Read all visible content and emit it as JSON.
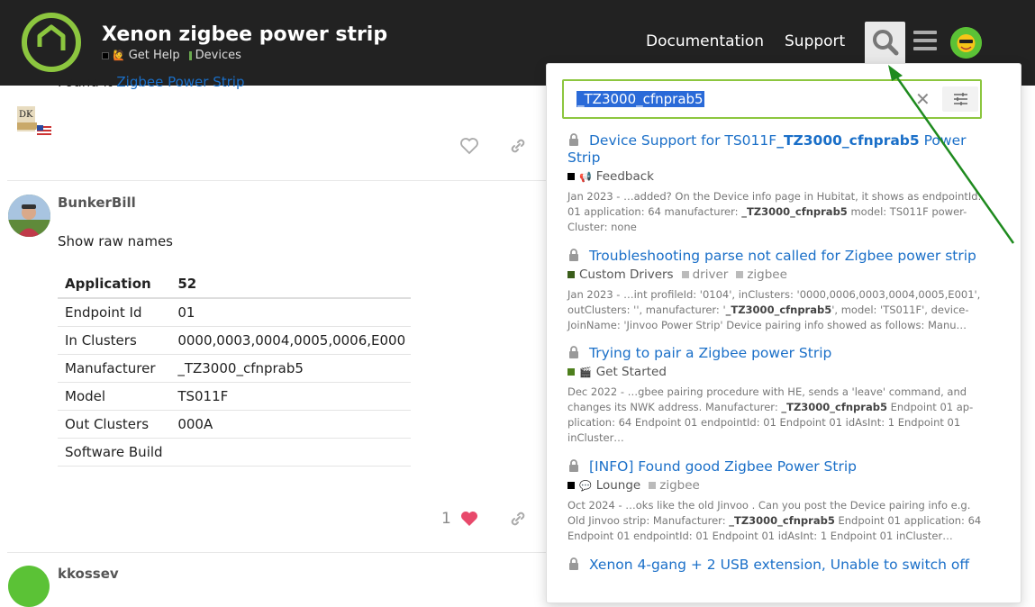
{
  "header": {
    "title": "Xenon zigbee power strip",
    "breadcrumbs": [
      {
        "label": "Get Help",
        "color": "#ffffff",
        "emoji": "🙋"
      },
      {
        "label": "Devices",
        "color": "#6aa84f"
      }
    ],
    "nav": {
      "documentation": "Documentation",
      "support": "Support"
    },
    "icons": {
      "search": "search-icon",
      "menu": "hamburger-icon",
      "avatar": "user-avatar"
    }
  },
  "topic": {
    "prev_post": {
      "text": "Found it ",
      "link": "Zigbee Power Strip"
    },
    "post": {
      "author": "BunkerBill",
      "body": "Show raw names",
      "table": {
        "headers": [
          "Application",
          "52"
        ],
        "rows": [
          [
            "Endpoint Id",
            "01"
          ],
          [
            "In Clusters",
            "0000,0003,0004,0005,0006,E000"
          ],
          [
            "Manufacturer",
            "_TZ3000_cfnprab5"
          ],
          [
            "Model",
            "TS011F"
          ],
          [
            "Out Clusters",
            "000A"
          ],
          [
            "Software Build",
            ""
          ]
        ]
      },
      "likes": "1"
    },
    "next_post": {
      "author": "kkossev"
    }
  },
  "search": {
    "query": "_TZ3000_cfnprab5",
    "results": [
      {
        "title_pre": "Device Support for TS011F",
        "title_match": "_TZ3000_cfnprab5",
        "title_post": " Power Strip",
        "category": "Feedback",
        "category_color": "#000000",
        "category_emoji": "📢",
        "tags": [],
        "blurb_pre": "Jan 2023 - …added? On the Device info page in Hubitat, it shows as endpointId: 01 application: 64 manufacturer: ",
        "blurb_match": "_TZ3000_cfnprab5",
        "blurb_post": " model: TS011F power-Cluster: none"
      },
      {
        "title_pre": "Troubleshooting parse not called for Zigbee power strip",
        "title_match": "",
        "title_post": "",
        "category": "Custom Drivers",
        "category_color": "#3b5e1b",
        "category_emoji": "",
        "tags": [
          "driver",
          "zigbee"
        ],
        "blurb_pre": "Jan 2023 - …int profileId: '0104', inClusters: '0000,0006,0003,0004,0005,E001', outClusters: '', manufacturer: '",
        "blurb_match": "_TZ3000_cfnprab5",
        "blurb_post": "', model: 'TS011F', device-JoinName: 'Jinvoo Power Strip' Device pairing info showed as follows: Manu…"
      },
      {
        "title_pre": "Trying to pair a Zigbee power Strip",
        "title_match": "",
        "title_post": "",
        "category": "Get Started",
        "category_color": "#4d7f1c",
        "category_emoji": "🎬",
        "tags": [],
        "blurb_pre": "Dec 2022 - …gbee pairing procedure with HE, sends a 'leave' command, and changes its NWK address. Manufacturer: ",
        "blurb_match": "_TZ3000_cfnprab5",
        "blurb_post": " Endpoint 01 ap-plication: 64 Endpoint 01 endpointId: 01 Endpoint 01 idAsInt: 1 Endpoint 01 inCluster…"
      },
      {
        "title_pre": "[INFO] Found good Zigbee Power Strip",
        "title_match": "",
        "title_post": "",
        "category": "Lounge",
        "category_color": "#000000",
        "category_emoji": "💬",
        "tags": [
          "zigbee"
        ],
        "blurb_pre": "Oct 2024 - …oks like the old Jinvoo . Can you post the Device pairing info e.g. Old Jinvoo strip: Manufacturer: ",
        "blurb_match": "_TZ3000_cfnprab5",
        "blurb_post": " Endpoint 01 application: 64 Endpoint 01 endpointId: 01 Endpoint 01 idAsInt: 1 Endpoint 01 inCluster…"
      },
      {
        "title_pre": "Xenon 4-gang + 2 USB extension, Unable to switch off",
        "title_match": "",
        "title_post": "",
        "category": "",
        "category_color": "#000000",
        "category_emoji": "",
        "tags": [],
        "blurb_pre": "",
        "blurb_match": "",
        "blurb_post": ""
      }
    ]
  },
  "colors": {
    "accent": "#1a6fc8",
    "header_bg": "#222222",
    "search_border": "#8cc63f",
    "arrow": "#1e8a1e",
    "like": "#e8496b"
  }
}
